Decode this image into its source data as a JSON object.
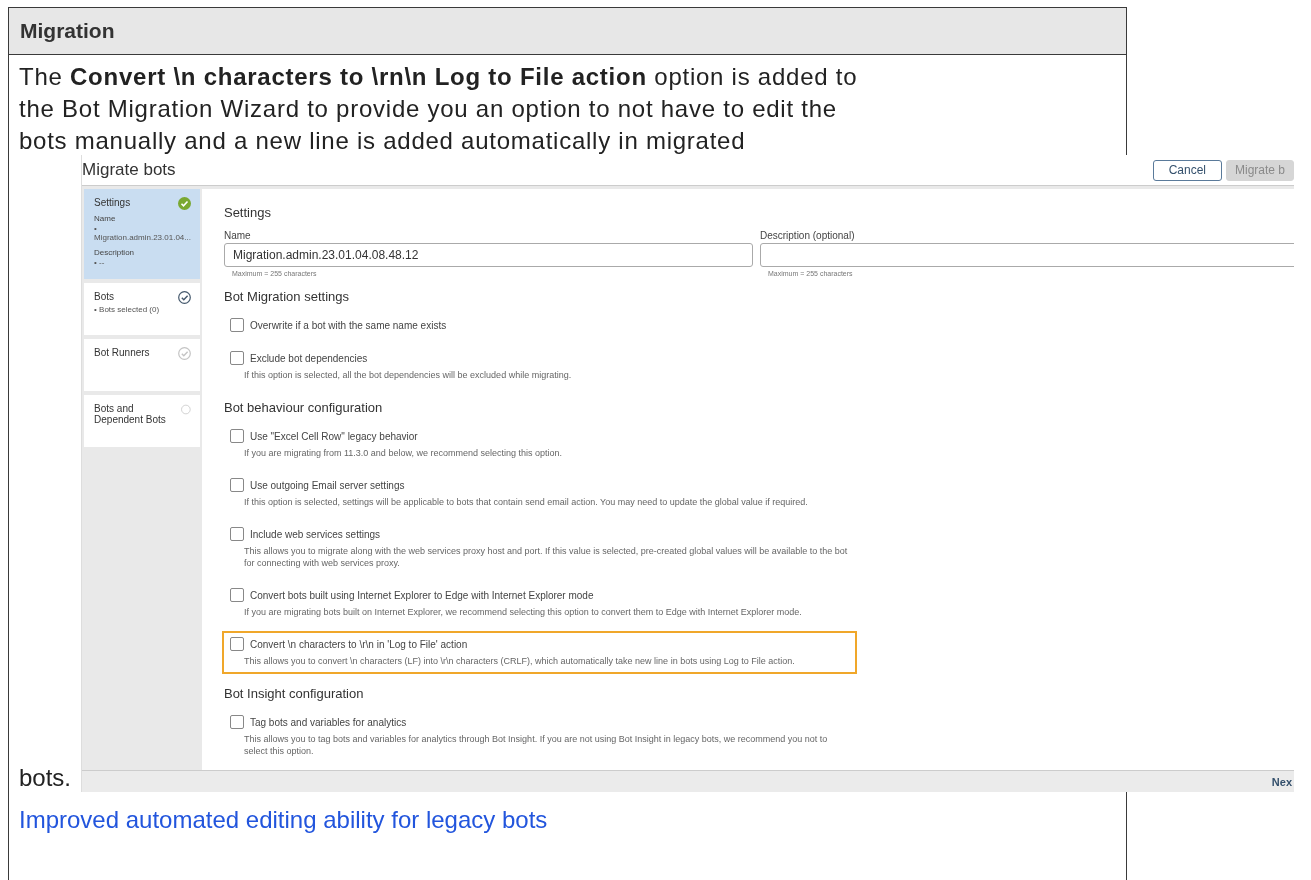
{
  "section": {
    "title": "Migration"
  },
  "intro": "The **Convert \\n characters to \\rn\\n Log to File action** option is added to the Bot Migration Wizard to provide you an option to not have to edit the bots manually and a new line is added automatically in migrated",
  "intro_end": "bots.",
  "screenshot": {
    "title": "Migrate bots",
    "buttons": [
      {
        "label": "Cancel",
        "disabled": false
      },
      {
        "label": "Migrate b",
        "disabled": true
      }
    ],
    "steps": [
      {
        "title": "Settings",
        "selected": true,
        "kind": "complete",
        "details": [
          {
            "kind": "heading",
            "text": "Name"
          },
          {
            "kind": "bullet",
            "text": "• Migration.admin.23.01.04..."
          },
          {
            "kind": "heading",
            "text": "Description"
          },
          {
            "kind": "bullet",
            "text": "• --"
          }
        ]
      },
      {
        "title": "Bots",
        "selected": false,
        "kind": "valid",
        "details": [
          {
            "kind": "bullet",
            "text": "• Bots selected (0)"
          }
        ]
      },
      {
        "title": "Bot Runners",
        "selected": false,
        "kind": "inactive"
      },
      {
        "title": "Bots and Dependent Bots",
        "selected": false,
        "kind": "empty"
      }
    ],
    "panel_title": "Settings",
    "fields": [
      {
        "label": "Name",
        "value": "Migration.admin.23.01.04.08.48.12",
        "hint": "Maximum = 255 characters"
      },
      {
        "label": "Description (optional)",
        "hint": "Maximum = 255 characters"
      }
    ],
    "groups": [
      {
        "title": "Bot Migration settings",
        "options": [
          {
            "label": "Overwrite if a bot with the same name exists",
            "checked": false,
            "highlighted": false
          },
          {
            "label": "Exclude bot dependencies",
            "checked": false,
            "highlighted": false,
            "description": "If this option is selected, all the bot dependencies will be excluded while migrating."
          }
        ]
      },
      {
        "title": "Bot behaviour configuration",
        "options": [
          {
            "label": "Use \"Excel Cell Row\" legacy behavior",
            "checked": false,
            "highlighted": false,
            "description": "If you are migrating from 11.3.0 and below, we recommend selecting this option."
          },
          {
            "label": "Use outgoing Email server settings",
            "checked": false,
            "highlighted": false,
            "description": "If this option is selected, settings will be applicable to bots that contain send email action. You may need to update the global value if required."
          },
          {
            "label": "Include web services settings",
            "checked": false,
            "highlighted": false,
            "description": "This allows you to migrate along with the web services proxy host and port. If this value is selected, pre-created global values will be available to the bot for connecting with web services proxy."
          },
          {
            "label": "Convert bots built using Internet Explorer to Edge with Internet Explorer mode",
            "checked": false,
            "highlighted": false,
            "description": "If you are migrating bots built on Internet Explorer, we recommend selecting this option to convert them to Edge with Internet Explorer mode."
          },
          {
            "label": "Convert \\n characters to \\r\\n in 'Log to File' action",
            "checked": false,
            "highlighted": true,
            "description": "This allows you to convert \\n characters (LF) into \\r\\n characters (CRLF), which automatically take new line in bots using Log to File action."
          }
        ]
      },
      {
        "title": "Bot Insight configuration",
        "options": [
          {
            "label": "Tag bots and variables for analytics",
            "checked": false,
            "highlighted": false,
            "description": "This allows you to tag bots and variables for analytics through Bot Insight. If you are not using Bot Insight in legacy bots, we recommend you not to select this option."
          }
        ]
      }
    ],
    "footer_button": "Nex"
  },
  "link": "Improved automated editing ability for legacy bots"
}
